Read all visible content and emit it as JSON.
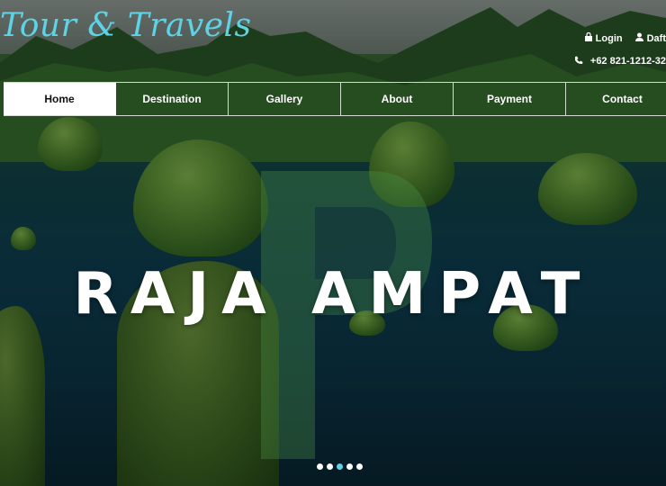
{
  "brand": {
    "name": "Tour & Travels"
  },
  "top_links": {
    "login": "Login",
    "register": "Daft",
    "phone": "+62 821-1212-32"
  },
  "nav": {
    "items": [
      "Home",
      "Destination",
      "Gallery",
      "About",
      "Payment",
      "Contact"
    ],
    "active": "Home"
  },
  "hero": {
    "title": "RAJA AMPAT"
  },
  "carousel": {
    "slide_count": 5,
    "active_index": 2
  },
  "colors": {
    "accent": "#5fd3e6",
    "nav_active_bg": "#ffffff"
  },
  "icons": {
    "login": "lock-icon",
    "register": "user-icon",
    "phone": "phone-icon"
  }
}
